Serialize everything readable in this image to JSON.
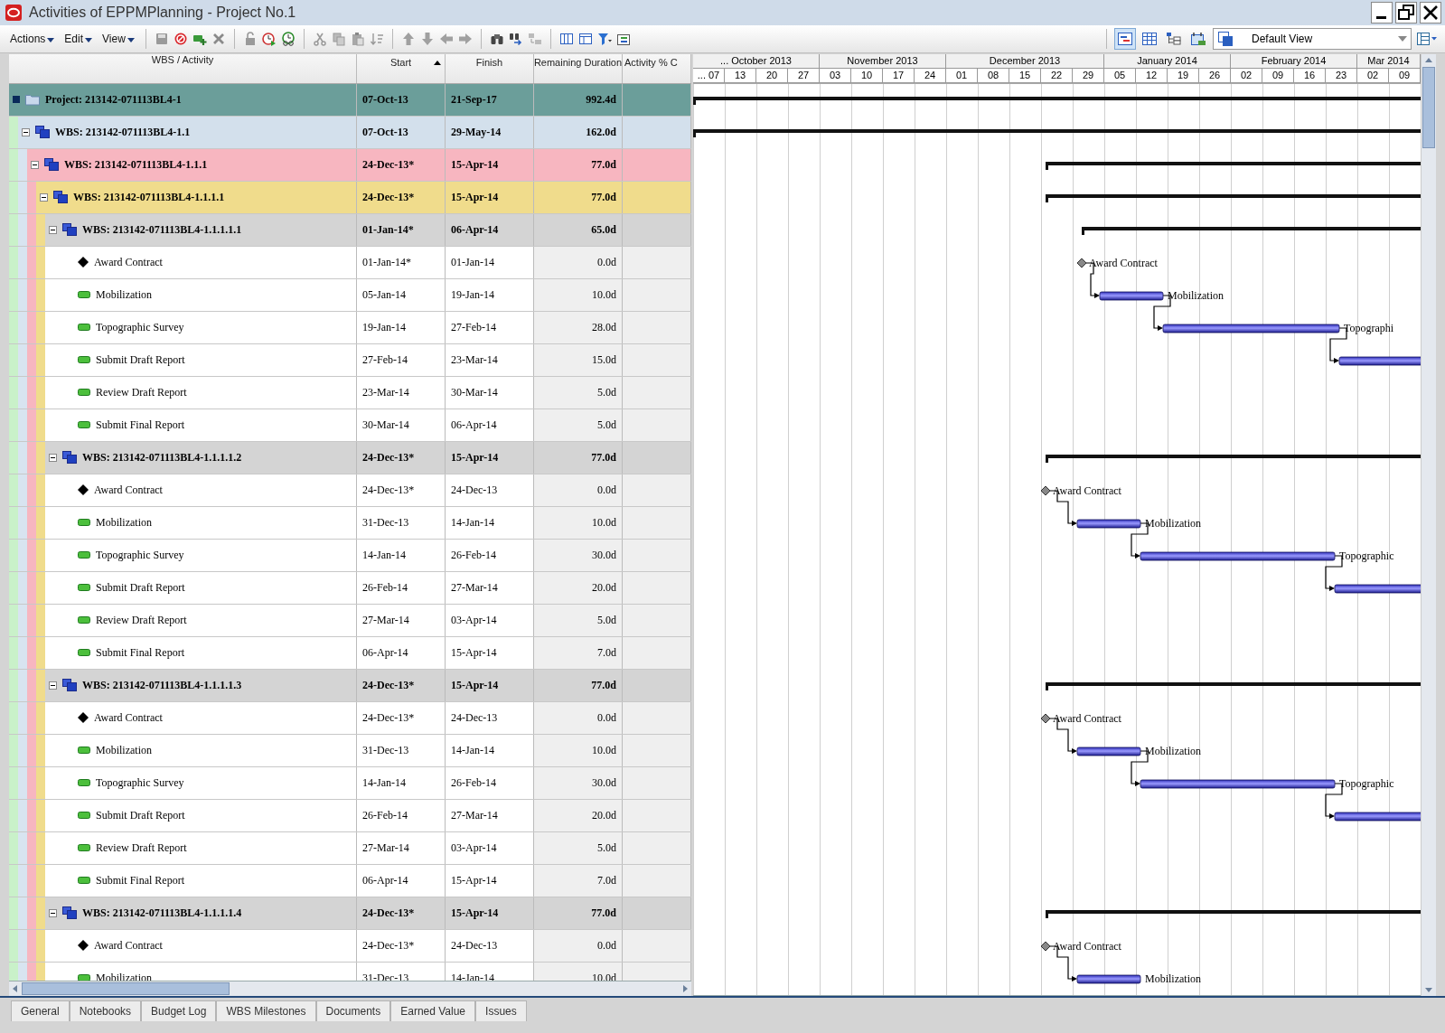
{
  "window": {
    "title": "Activities of EPPMPlanning - Project No.1"
  },
  "menus": [
    "Actions",
    "Edit",
    "View"
  ],
  "view_selector": {
    "value": "Default View"
  },
  "columns": [
    {
      "label": "WBS / Activity",
      "sorted": false
    },
    {
      "label": "Start",
      "sorted": true
    },
    {
      "label": "Finish",
      "sorted": false
    },
    {
      "label": "Remaining Duration",
      "sorted": false
    },
    {
      "label": "Activity % C",
      "sorted": false
    }
  ],
  "timeline": {
    "months": [
      {
        "label": "... October 2013",
        "weeks": [
          "... 07",
          "13",
          "20",
          "27"
        ]
      },
      {
        "label": "November 2013",
        "weeks": [
          "03",
          "10",
          "17",
          "24"
        ]
      },
      {
        "label": "December 2013",
        "weeks": [
          "01",
          "08",
          "15",
          "22",
          "29"
        ]
      },
      {
        "label": "January 2014",
        "weeks": [
          "05",
          "12",
          "19",
          "26"
        ]
      },
      {
        "label": "February 2014",
        "weeks": [
          "02",
          "09",
          "16",
          "23"
        ]
      },
      {
        "label": "Mar 2014",
        "weeks": [
          "02",
          "09"
        ]
      }
    ]
  },
  "project": {
    "kind": "project",
    "name": "Project: 213142-071113BL4-1",
    "start": "07-Oct-13",
    "finish": "21-Sep-17",
    "remaining": "992.4d",
    "children": [
      {
        "kind": "wbs",
        "name": "WBS: 213142-071113BL4-1.1",
        "start": "07-Oct-13",
        "finish": "29-May-14",
        "remaining": "162.0d",
        "expanded": true,
        "children": [
          {
            "kind": "wbs",
            "name": "WBS: 213142-071113BL4-1.1.1",
            "start": "24-Dec-13*",
            "finish": "15-Apr-14",
            "remaining": "77.0d",
            "expanded": true,
            "children": [
              {
                "kind": "wbs",
                "name": "WBS: 213142-071113BL4-1.1.1.1",
                "start": "24-Dec-13*",
                "finish": "15-Apr-14",
                "remaining": "77.0d",
                "expanded": true,
                "children": [
                  {
                    "kind": "wbs",
                    "name": "WBS: 213142-071113BL4-1.1.1.1.1",
                    "start": "01-Jan-14*",
                    "finish": "06-Apr-14",
                    "remaining": "65.0d",
                    "expanded": true,
                    "children": [
                      {
                        "kind": "milestone",
                        "name": "Award Contract",
                        "start": "01-Jan-14*",
                        "finish": "01-Jan-14",
                        "remaining": "0.0d",
                        "bar_label": "Award Contract"
                      },
                      {
                        "kind": "task",
                        "name": "Mobilization",
                        "start": "05-Jan-14",
                        "finish": "19-Jan-14",
                        "remaining": "10.0d",
                        "bar_label": "Mobilization"
                      },
                      {
                        "kind": "task",
                        "name": "Topographic Survey",
                        "start": "19-Jan-14",
                        "finish": "27-Feb-14",
                        "remaining": "28.0d",
                        "bar_label": "Topographi"
                      },
                      {
                        "kind": "task",
                        "name": "Submit Draft Report",
                        "start": "27-Feb-14",
                        "finish": "23-Mar-14",
                        "remaining": "15.0d"
                      },
                      {
                        "kind": "task",
                        "name": "Review Draft Report",
                        "start": "23-Mar-14",
                        "finish": "30-Mar-14",
                        "remaining": "5.0d"
                      },
                      {
                        "kind": "task",
                        "name": "Submit Final Report",
                        "start": "30-Mar-14",
                        "finish": "06-Apr-14",
                        "remaining": "5.0d"
                      }
                    ]
                  },
                  {
                    "kind": "wbs",
                    "name": "WBS: 213142-071113BL4-1.1.1.1.2",
                    "start": "24-Dec-13*",
                    "finish": "15-Apr-14",
                    "remaining": "77.0d",
                    "expanded": true,
                    "children": [
                      {
                        "kind": "milestone",
                        "name": "Award Contract",
                        "start": "24-Dec-13*",
                        "finish": "24-Dec-13",
                        "remaining": "0.0d",
                        "bar_label": "Award Contract"
                      },
                      {
                        "kind": "task",
                        "name": "Mobilization",
                        "start": "31-Dec-13",
                        "finish": "14-Jan-14",
                        "remaining": "10.0d",
                        "bar_label": "Mobilization"
                      },
                      {
                        "kind": "task",
                        "name": "Topographic Survey",
                        "start": "14-Jan-14",
                        "finish": "26-Feb-14",
                        "remaining": "30.0d",
                        "bar_label": "Topographic"
                      },
                      {
                        "kind": "task",
                        "name": "Submit Draft Report",
                        "start": "26-Feb-14",
                        "finish": "27-Mar-14",
                        "remaining": "20.0d"
                      },
                      {
                        "kind": "task",
                        "name": "Review Draft Report",
                        "start": "27-Mar-14",
                        "finish": "03-Apr-14",
                        "remaining": "5.0d"
                      },
                      {
                        "kind": "task",
                        "name": "Submit Final Report",
                        "start": "06-Apr-14",
                        "finish": "15-Apr-14",
                        "remaining": "7.0d"
                      }
                    ]
                  },
                  {
                    "kind": "wbs",
                    "name": "WBS: 213142-071113BL4-1.1.1.1.3",
                    "start": "24-Dec-13*",
                    "finish": "15-Apr-14",
                    "remaining": "77.0d",
                    "expanded": true,
                    "children": [
                      {
                        "kind": "milestone",
                        "name": "Award Contract",
                        "start": "24-Dec-13*",
                        "finish": "24-Dec-13",
                        "remaining": "0.0d",
                        "bar_label": "Award Contract"
                      },
                      {
                        "kind": "task",
                        "name": "Mobilization",
                        "start": "31-Dec-13",
                        "finish": "14-Jan-14",
                        "remaining": "10.0d",
                        "bar_label": "Mobilization"
                      },
                      {
                        "kind": "task",
                        "name": "Topographic Survey",
                        "start": "14-Jan-14",
                        "finish": "26-Feb-14",
                        "remaining": "30.0d",
                        "bar_label": "Topographic"
                      },
                      {
                        "kind": "task",
                        "name": "Submit Draft Report",
                        "start": "26-Feb-14",
                        "finish": "27-Mar-14",
                        "remaining": "20.0d"
                      },
                      {
                        "kind": "task",
                        "name": "Review Draft Report",
                        "start": "27-Mar-14",
                        "finish": "03-Apr-14",
                        "remaining": "5.0d"
                      },
                      {
                        "kind": "task",
                        "name": "Submit Final Report",
                        "start": "06-Apr-14",
                        "finish": "15-Apr-14",
                        "remaining": "7.0d"
                      }
                    ]
                  },
                  {
                    "kind": "wbs",
                    "name": "WBS: 213142-071113BL4-1.1.1.1.4",
                    "start": "24-Dec-13*",
                    "finish": "15-Apr-14",
                    "remaining": "77.0d",
                    "expanded": true,
                    "children": [
                      {
                        "kind": "milestone",
                        "name": "Award Contract",
                        "start": "24-Dec-13*",
                        "finish": "24-Dec-13",
                        "remaining": "0.0d",
                        "bar_label": "Award Contract"
                      },
                      {
                        "kind": "task",
                        "name": "Mobilization",
                        "start": "31-Dec-13",
                        "finish": "14-Jan-14",
                        "remaining": "10.0d",
                        "bar_label": "Mobilization"
                      }
                    ]
                  }
                ]
              }
            ]
          }
        ]
      }
    ]
  },
  "bottom_tabs": [
    "General",
    "Notebooks",
    "Budget Log",
    "WBS Milestones",
    "Documents",
    "Earned Value",
    "Issues"
  ]
}
